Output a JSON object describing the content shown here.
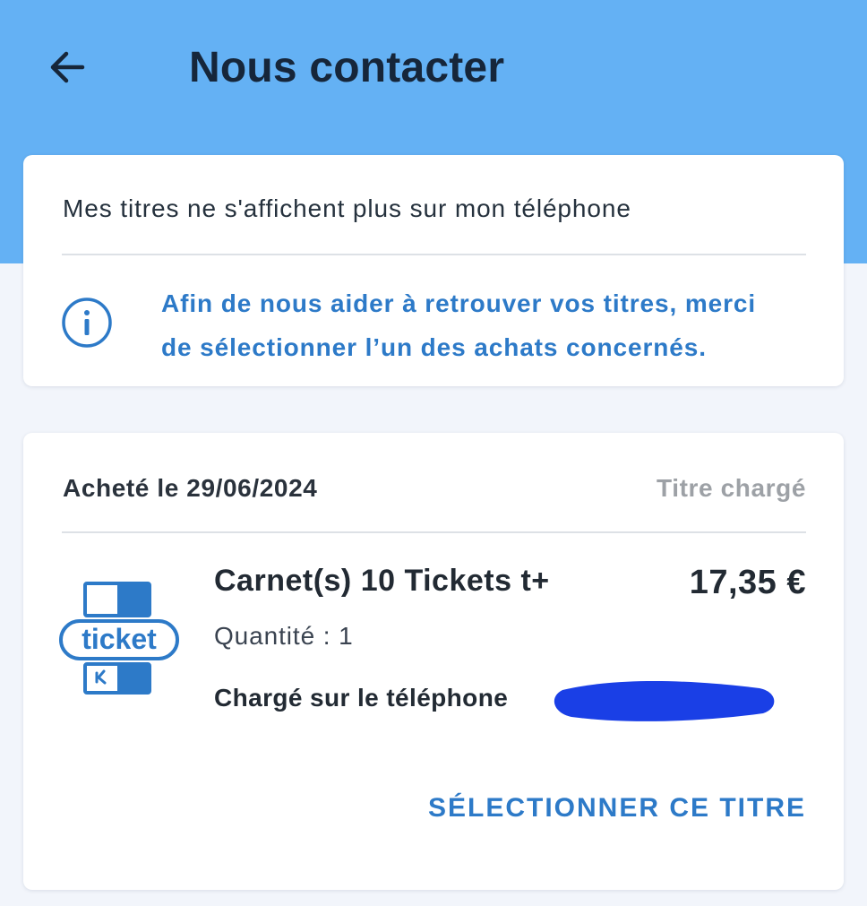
{
  "header": {
    "title": "Nous contacter",
    "back_icon": "arrow-left-icon",
    "background_color": "#64b1f4"
  },
  "subject_card": {
    "subject": "Mes titres ne s'affichent plus sur mon téléphone",
    "info_icon": "info-circle-icon",
    "info_line_1": "Afin de nous aider à retrouver vos titres, merci",
    "info_line_2": "de sélectionner l’un des achats concernés.",
    "accent_color": "#2d7ac8"
  },
  "purchase_card": {
    "purchase_date": "Acheté le 29/06/2024",
    "status": "Titre chargé",
    "logo": {
      "icon": "ticket-logo-icon",
      "text": "ticket"
    },
    "product_name": "Carnet(s) 10 Tickets t+",
    "price": "17,35 €",
    "quantity": "Quantité : 1",
    "device_label": "Chargé sur le téléphone",
    "redaction_color": "#1a3fe6",
    "select_button": "SÉLECTIONNER CE TITRE"
  }
}
